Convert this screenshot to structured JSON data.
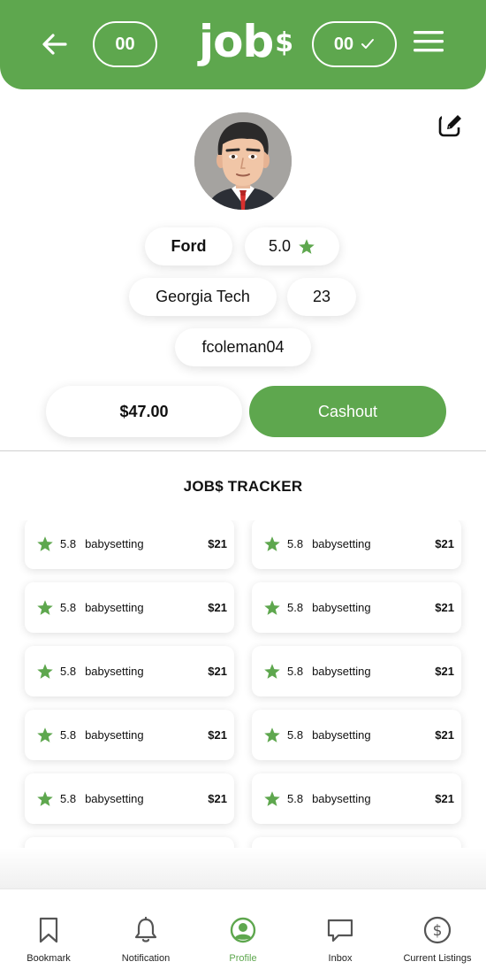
{
  "header": {
    "left_count": "00",
    "right_count": "00",
    "logo_text": "job",
    "logo_symbol": "$",
    "icons": [
      "back-arrow-icon",
      "check-icon",
      "hamburger-menu-icon"
    ]
  },
  "profile": {
    "name": "Ford",
    "rating": "5.0",
    "school": "Georgia Tech",
    "age": "23",
    "username": "fcoleman04",
    "balance": "$47.00",
    "cashout_label": "Cashout",
    "icons": [
      "edit-icon",
      "avatar-portrait",
      "star-icon"
    ]
  },
  "tracker": {
    "title": "JOB$ TRACKER",
    "jobs": [
      {
        "rating": "5.8",
        "job": "babysetting",
        "pay": "$21"
      },
      {
        "rating": "5.8",
        "job": "babysetting",
        "pay": "$21"
      },
      {
        "rating": "5.8",
        "job": "babysetting",
        "pay": "$21"
      },
      {
        "rating": "5.8",
        "job": "babysetting",
        "pay": "$21"
      },
      {
        "rating": "5.8",
        "job": "babysetting",
        "pay": "$21"
      },
      {
        "rating": "5.8",
        "job": "babysetting",
        "pay": "$21"
      },
      {
        "rating": "5.8",
        "job": "babysetting",
        "pay": "$21"
      },
      {
        "rating": "5.8",
        "job": "babysetting",
        "pay": "$21"
      },
      {
        "rating": "5.8",
        "job": "babysetting",
        "pay": "$21"
      },
      {
        "rating": "5.8",
        "job": "babysetting",
        "pay": "$21"
      }
    ]
  },
  "nav": {
    "items": [
      {
        "label": "Bookmark",
        "icon": "bookmark-icon"
      },
      {
        "label": "Notification",
        "icon": "bell-icon"
      },
      {
        "label": "Profile",
        "icon": "profile-icon"
      },
      {
        "label": "Inbox",
        "icon": "chat-bubble-icon"
      },
      {
        "label": "Current Listings",
        "icon": "dollar-circle-icon"
      }
    ],
    "active_index": 2
  },
  "colors": {
    "brand_green": "#5ea74e",
    "background": "#ffffff",
    "text": "#111111"
  }
}
